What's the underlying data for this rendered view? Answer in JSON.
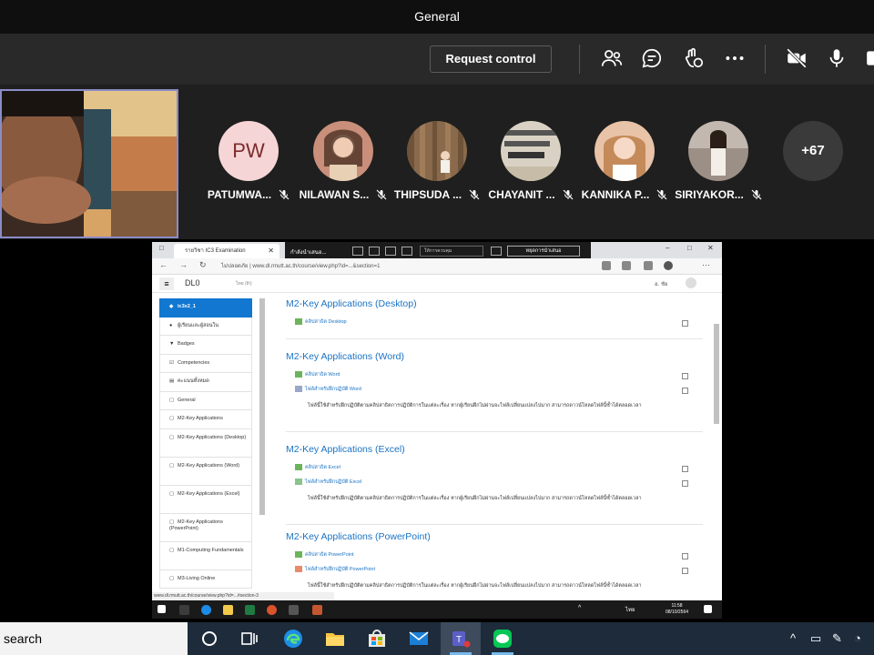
{
  "window": {
    "title": "General"
  },
  "toolbar": {
    "request_control_label": "Request control",
    "icons": [
      "people-icon",
      "chat-icon",
      "reactions-icon",
      "more-icon",
      "camera-off-icon",
      "mic-icon"
    ]
  },
  "participants": [
    {
      "name": "PATUMWA...",
      "initials": "PW",
      "avatar_color": "#f5d5d5"
    },
    {
      "name": "NILAWAN S...",
      "initials": "",
      "avatar_color": "#c98f7a"
    },
    {
      "name": "THIPSUDA ...",
      "initials": "",
      "avatar_color": "#8a6a4c"
    },
    {
      "name": "CHAYANIT ...",
      "initials": "",
      "avatar_color": "#d9d2c4"
    },
    {
      "name": "KANNIKA P...",
      "initials": "",
      "avatar_color": "#e9c3a7"
    },
    {
      "name": "SIRIYAKOR...",
      "initials": "",
      "avatar_color": "#9c8f86"
    }
  ],
  "overflow_count": "+67",
  "shared_screen": {
    "tab_title": "รายวิชา IC3 Examination",
    "presenting_label": "กำลังนำเสนอ...",
    "control_select": "ให้การควบคุม",
    "stop_presenting": "หยุดการนำเสนอ",
    "url_prefix": "ไม่ปลอดภัย",
    "url": "www.dl.rmutt.ac.th/course/view.php?id=...&section=1",
    "site_brand": "DL0",
    "site_lang": "ไทย (th)",
    "user_name": "อ. ชัย",
    "sidebar": [
      {
        "label": "ic3x2_1",
        "active": true,
        "icon": "hat-icon"
      },
      {
        "label": "ผู้เรียนและผู้สอนใน",
        "active": false,
        "icon": "users-icon"
      },
      {
        "label": "Badges",
        "active": false,
        "icon": "badge-icon"
      },
      {
        "label": "Competencies",
        "active": false,
        "icon": "check-icon"
      },
      {
        "label": "คะแนนทั้งหมด",
        "active": false,
        "icon": "grades-icon"
      },
      {
        "label": "General",
        "active": false,
        "icon": "folder-icon"
      },
      {
        "label": "M2-Key Applications",
        "active": false,
        "icon": "folder-icon"
      },
      {
        "label": "M2-Key Applications (Desktop)",
        "active": false,
        "icon": "folder-icon"
      },
      {
        "label": "M2-Key Applications (Word)",
        "active": false,
        "icon": "folder-icon"
      },
      {
        "label": "M2-Key Applications (Excel)",
        "active": false,
        "icon": "folder-icon"
      },
      {
        "label": "M2-Key Applications (PowerPoint)",
        "active": false,
        "icon": "folder-icon"
      },
      {
        "label": "M1-Computing Fundamentals",
        "active": false,
        "icon": "folder-icon"
      },
      {
        "label": "M3-Living Online",
        "active": false,
        "icon": "folder-icon"
      }
    ],
    "sections": [
      {
        "title": "M2-Key Applications (Desktop)",
        "items": [
          "คลิปสาธิต Desktop"
        ],
        "desc": ""
      },
      {
        "title": "M2-Key Applications (Word)",
        "items": [
          "คลิปสาธิต Word",
          "ไฟล์สำหรับฝึกปฏิบัติ Word"
        ],
        "desc": "ไฟล์นี้ใช้สำหรับฝึกปฏิบัติตามคลิปสาธิตการปฏิบัติการในแต่ละเรื่อง หากผู้เรียนฝึกไม่ผ่านจะไฟล์เปลี่ยนแปลงไปมาก สามารถดาวน์โหลดไฟล์นี้ซ้ำได้ตลอดเวลา"
      },
      {
        "title": "M2-Key Applications (Excel)",
        "items": [
          "คลิปสาธิต Excel",
          "ไฟล์สำหรับฝึกปฏิบัติ Excel"
        ],
        "desc": "ไฟล์นี้ใช้สำหรับฝึกปฏิบัติตามคลิปสาธิตการปฏิบัติการในแต่ละเรื่อง หากผู้เรียนฝึกไม่ผ่านจะไฟล์เปลี่ยนแปลงไปมาก สามารถดาวน์โหลดไฟล์นี้ซ้ำได้ตลอดเวลา"
      },
      {
        "title": "M2-Key Applications (PowerPoint)",
        "items": [
          "คลิปสาธิต PowerPoint",
          "ไฟล์สำหรับฝึกปฏิบัติ PowerPoint"
        ],
        "desc": "ไฟล์นี้ใช้สำหรับฝึกปฏิบัติตามคลิปสาธิตการปฏิบัติการในแต่ละเรื่อง หากผู้เรียนฝึกไม่ผ่านจะไฟล์เปลี่ยนแปลงไปมาก สามารถดาวน์โหลดไฟล์นี้ซ้ำได้ตลอดเวลา"
      }
    ],
    "status_url": "www.dl.rmutt.ac.th/course/view.php?id=...#section-3",
    "clock_time": "11:58",
    "clock_date": "08/10/2564",
    "lang": "ไทย"
  },
  "taskbar": {
    "search_label": "search",
    "apps": [
      "cortana-icon",
      "task-view-icon",
      "edge-icon",
      "file-explorer-icon",
      "store-icon",
      "mail-icon",
      "teams-icon",
      "line-icon"
    ]
  }
}
